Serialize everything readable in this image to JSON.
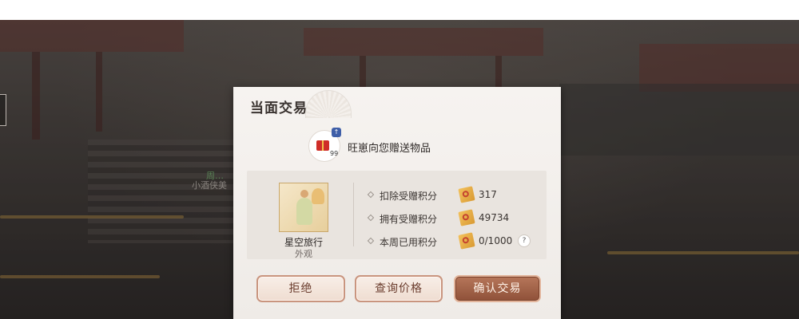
{
  "background": {
    "npc_name": "周…",
    "npc_subtitle": "小酒侠美"
  },
  "dialog": {
    "title": "当面交易",
    "sender": {
      "text": "旺崽向您赠送物品",
      "gift_count": "99",
      "badge_icon": "gift-badge-icon"
    },
    "item": {
      "name": "星空旅行",
      "type": "外观"
    },
    "stats": [
      {
        "label": "扣除受赠积分",
        "value": "317",
        "icon": "ticket-icon"
      },
      {
        "label": "拥有受赠积分",
        "value": "49734",
        "icon": "ticket-icon"
      },
      {
        "label": "本周已用积分",
        "value": "0/1000",
        "icon": "ticket-icon",
        "help": "?"
      }
    ],
    "buttons": {
      "reject": "拒绝",
      "query_price": "查询价格",
      "confirm": "确认交易"
    }
  },
  "colors": {
    "accent": "#8f5139",
    "panel_bg": "#f6f3f0",
    "button_border": "#c9957f"
  }
}
